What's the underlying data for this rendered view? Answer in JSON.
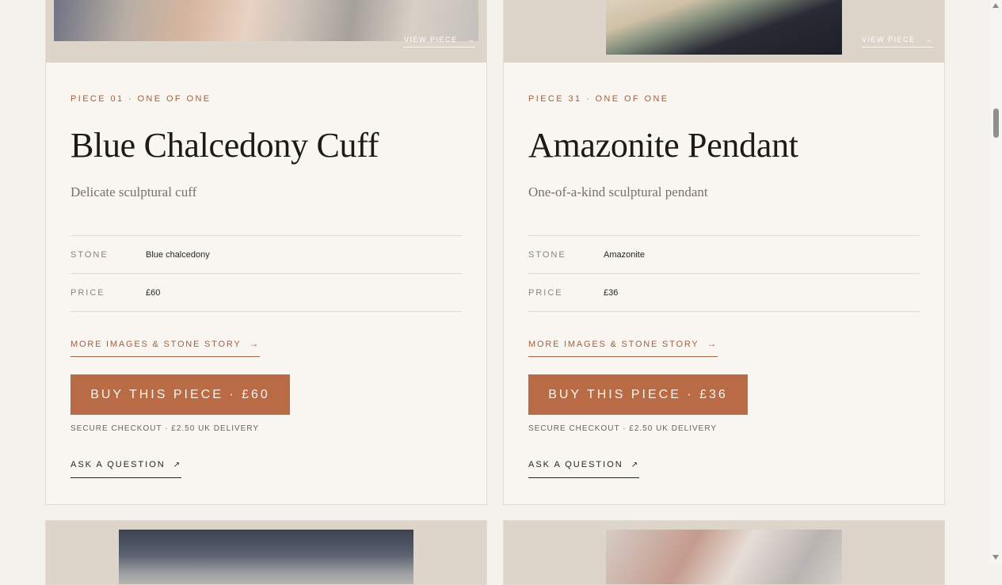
{
  "cards": [
    {
      "view_label": "VIEW PIECE",
      "eyebrow": "PIECE 01 · ONE OF ONE",
      "title": "Blue Chalcedony Cuff",
      "subtitle": "Delicate sculptural cuff",
      "stone_label": "STONE",
      "stone_value": "Blue chalcedony",
      "price_label": "PRICE",
      "price_value": "£60",
      "more_link": "MORE IMAGES & STONE STORY",
      "buy_label": "BUY THIS PIECE · £60",
      "checkout_note": "SECURE CHECKOUT · £2.50 UK DELIVERY",
      "ask_label": "ASK A QUESTION"
    },
    {
      "view_label": "VIEW PIECE",
      "eyebrow": "PIECE 31 · ONE OF ONE",
      "title": "Amazonite Pendant",
      "subtitle": "One-of-a-kind sculptural pendant",
      "stone_label": "STONE",
      "stone_value": "Amazonite",
      "price_label": "PRICE",
      "price_value": "£36",
      "more_link": "MORE IMAGES & STONE STORY",
      "buy_label": "BUY THIS PIECE · £36",
      "checkout_note": "SECURE CHECKOUT · £2.50 UK DELIVERY",
      "ask_label": "ASK A QUESTION"
    }
  ],
  "glyphs": {
    "arrow_right": "→",
    "arrow_diagonal": "↗"
  },
  "colors": {
    "accent": "#b96b46",
    "eyebrow": "#a45f3e",
    "page_bg": "#f5f2ed",
    "card_bg": "#f9f6f1"
  }
}
